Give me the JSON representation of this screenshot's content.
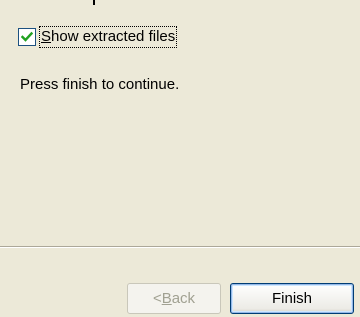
{
  "options": {
    "show_extracted_files": {
      "checked": true,
      "label_accel": "S",
      "label_rest": "how extracted files"
    }
  },
  "message": "Press finish to continue.",
  "buttons": {
    "back": {
      "prefix": "< ",
      "accel": "B",
      "rest": "ack",
      "enabled": false
    },
    "finish": {
      "label": "Finish",
      "enabled": true
    }
  },
  "icons": {
    "checkbox_mark": "check-icon"
  },
  "colors": {
    "dialog_background": "#ece9d8",
    "check_mark": "#21a121",
    "default_button_border": "#003c74",
    "disabled_text": "#a1a192"
  }
}
